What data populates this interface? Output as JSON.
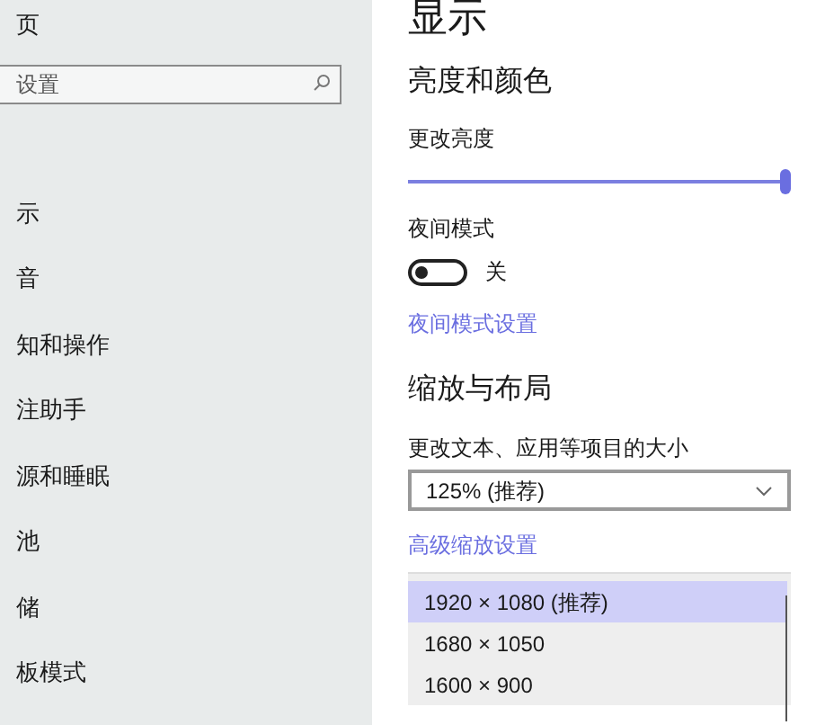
{
  "sidebar": {
    "home": "页",
    "search": {
      "placeholder": "设置"
    },
    "items": [
      {
        "label": "示"
      },
      {
        "label": "音"
      },
      {
        "label": "知和操作"
      },
      {
        "label": "注助手"
      },
      {
        "label": "源和睡眠"
      },
      {
        "label": "池"
      },
      {
        "label": "储"
      },
      {
        "label": "板模式"
      }
    ]
  },
  "main": {
    "title": "显示",
    "section1": "亮度和颜色",
    "brightness": {
      "label": "更改亮度",
      "level": 1.0
    },
    "night_mode": {
      "label": "夜间模式",
      "on": false,
      "state_text": "关"
    },
    "night_link": "夜间模式设置",
    "section2": "缩放与布局",
    "scale_label": "更改文本、应用等项目的大小",
    "scale_value": "125% (推荐)",
    "scale_link": "高级缩放设置",
    "resolutions": [
      {
        "label": "1920 × 1080 (推荐)",
        "selected": true
      },
      {
        "label": "1680 × 1050",
        "selected": false
      },
      {
        "label": "1600 × 900",
        "selected": false
      }
    ]
  }
}
